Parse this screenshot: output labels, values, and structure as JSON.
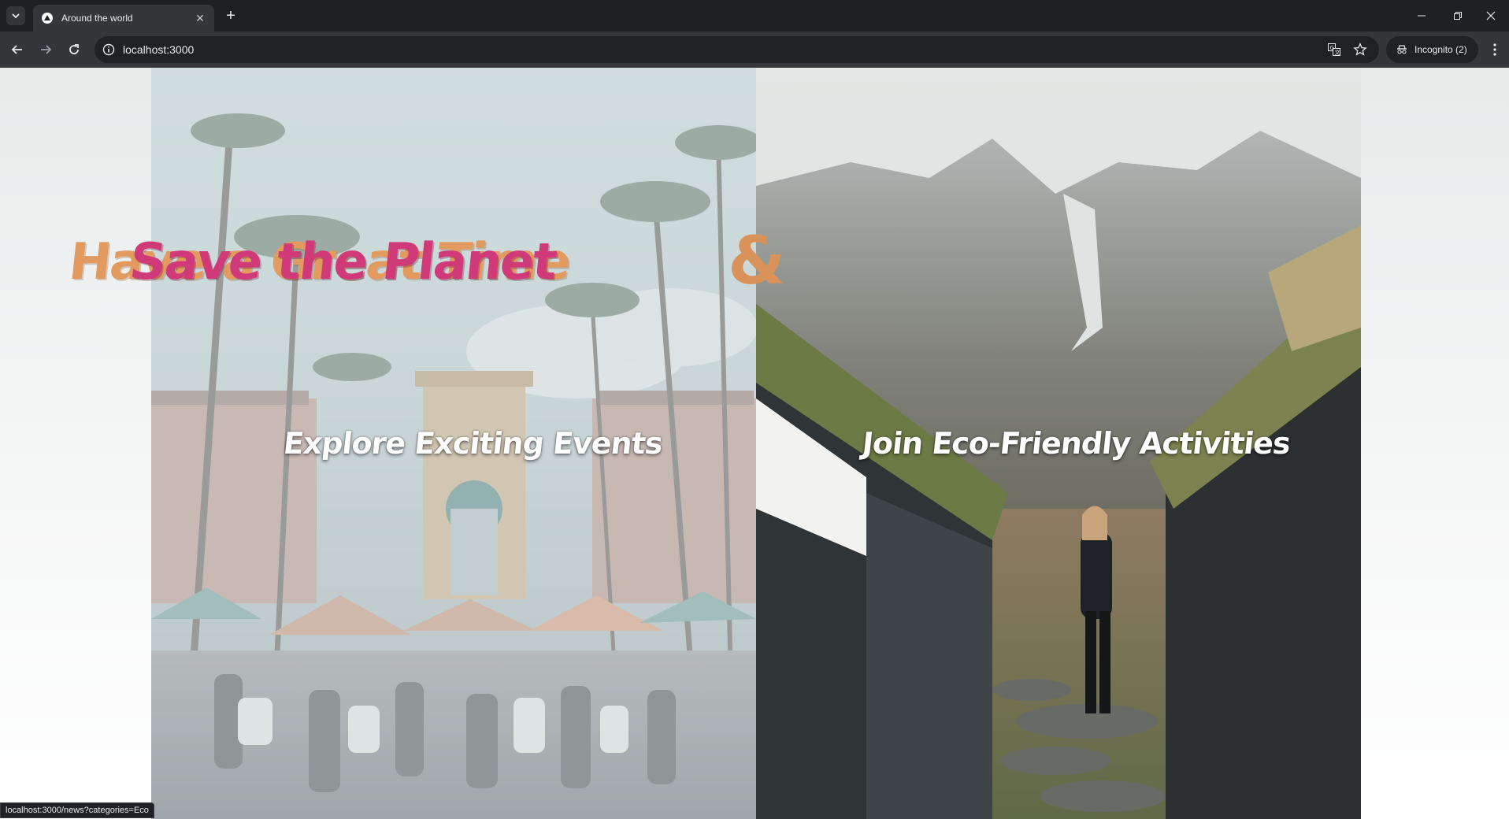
{
  "browser": {
    "tab_title": "Around the world",
    "url": "localhost:3000",
    "incognito_label": "Incognito (2)",
    "status_url": "localhost:3000/news?categories=Eco"
  },
  "hero": {
    "left_title": "Have a Great Time",
    "ampersand": "&",
    "right_title": "Save the Planet",
    "left_subtitle": "Explore Exciting Events",
    "right_subtitle": "Join Eco-Friendly Activities"
  },
  "colors": {
    "left_title": "#e39a5f",
    "right_title": "#d13a78",
    "chrome_dark": "#1f2023",
    "toolbar": "#35363a"
  },
  "icons": [
    "tab-search-icon",
    "favicon-icon",
    "close-icon",
    "plus-icon",
    "minimize-icon",
    "restore-icon",
    "window-close-icon",
    "back-icon",
    "forward-icon",
    "reload-icon",
    "info-icon",
    "translate-icon",
    "star-icon",
    "incognito-icon",
    "kebab-menu-icon"
  ]
}
